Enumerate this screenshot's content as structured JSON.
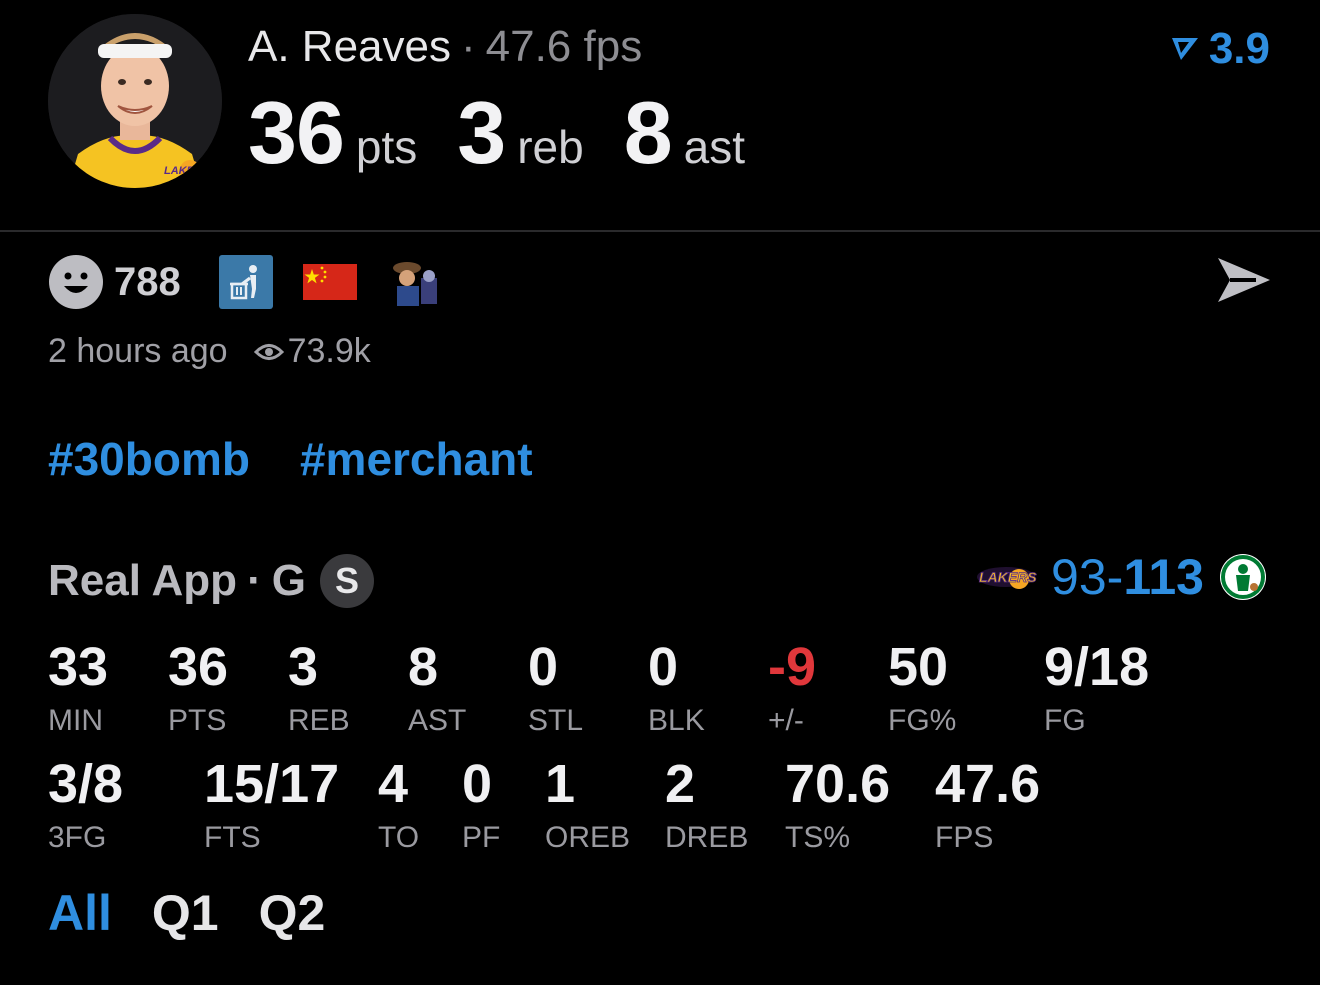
{
  "header": {
    "player_name": "A. Reaves",
    "separator": "·",
    "fps_label": "47.6 fps",
    "rating": "3.9",
    "team_logo_text": "LAKERS",
    "big_stats": [
      {
        "value": "36",
        "unit": "pts"
      },
      {
        "value": "3",
        "unit": "reb"
      },
      {
        "value": "8",
        "unit": "ast"
      }
    ]
  },
  "reactions": {
    "count": "788",
    "icons": [
      "smile-icon",
      "trash-person-icon",
      "china-flag-icon",
      "woody-sticker-icon"
    ]
  },
  "meta": {
    "time_ago": "2 hours ago",
    "views": "73.9k"
  },
  "tags": [
    "#30bomb",
    "#merchant"
  ],
  "game": {
    "source": "Real App",
    "separator": "·",
    "position": "G",
    "badge": "S",
    "away_logo_text": "LAKERS",
    "score_away": "93",
    "score_dash": "-",
    "score_home": "113"
  },
  "stats_row1": [
    {
      "value": "33",
      "label": "MIN"
    },
    {
      "value": "36",
      "label": "PTS"
    },
    {
      "value": "3",
      "label": "REB"
    },
    {
      "value": "8",
      "label": "AST"
    },
    {
      "value": "0",
      "label": "STL"
    },
    {
      "value": "0",
      "label": "BLK"
    },
    {
      "value": "-9",
      "label": "+/-"
    },
    {
      "value": "50",
      "label": "FG%"
    },
    {
      "value": "9/18",
      "label": "FG"
    }
  ],
  "stats_row2": [
    {
      "value": "3/8",
      "label": "3FG"
    },
    {
      "value": "15/17",
      "label": "FTS"
    },
    {
      "value": "4",
      "label": "TO"
    },
    {
      "value": "0",
      "label": "PF"
    },
    {
      "value": "1",
      "label": "OREB"
    },
    {
      "value": "2",
      "label": "DREB"
    },
    {
      "value": "70.6",
      "label": "TS%"
    },
    {
      "value": "47.6",
      "label": "FPS"
    }
  ],
  "filters": [
    {
      "label": "All",
      "active": true
    },
    {
      "label": "Q1",
      "active": false
    },
    {
      "label": "Q2",
      "active": false
    }
  ],
  "colors": {
    "accent": "#2f8ee0",
    "negative": "#e0373b",
    "background": "#000000"
  }
}
